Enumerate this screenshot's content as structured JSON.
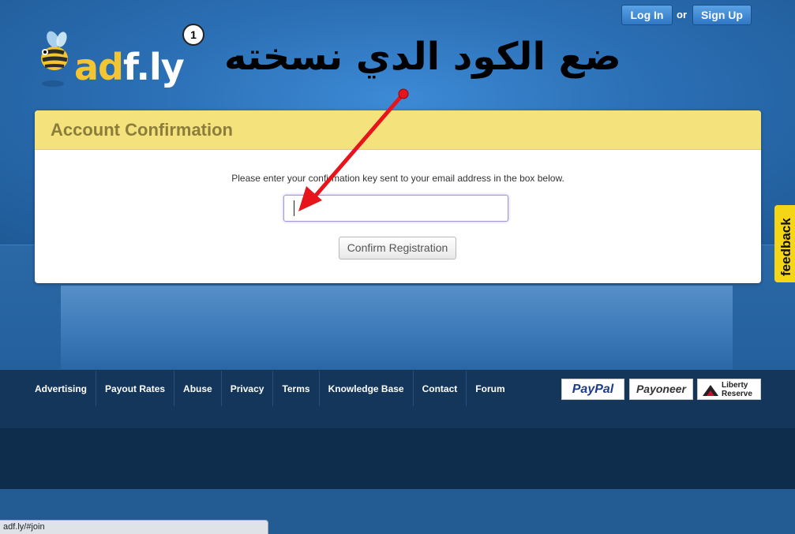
{
  "header": {
    "login_label": "Log In",
    "or_label": "or",
    "signup_label": "Sign Up"
  },
  "logo": {
    "brand_part1": "ad",
    "brand_part2": "f.ly",
    "icon": "bee-icon"
  },
  "annotation": {
    "step_number": "1",
    "arabic_text": "ضع الكود الدي نسخته",
    "arrow_color": "#e8141c"
  },
  "card": {
    "title": "Account Confirmation",
    "instructions": "Please enter your confirmation key sent to your email address in the box below.",
    "input_value": "",
    "button_label": "Confirm Registration"
  },
  "feedback_tab": {
    "label": "feedback"
  },
  "footer": {
    "links": [
      "Advertising",
      "Payout Rates",
      "Abuse",
      "Privacy",
      "Terms",
      "Knowledge Base",
      "Contact",
      "Forum"
    ],
    "payment_logos": {
      "paypal": "PayPal",
      "payoneer": "Payoneer",
      "liberty_line1": "Liberty",
      "liberty_line2": "Reserve"
    }
  },
  "status_bar": {
    "url": "adf.ly/#join"
  },
  "colors": {
    "accent_yellow": "#f4e37d",
    "page_blue": "#2b6fb4",
    "footer_navy": "#13365a",
    "feedback_yellow": "#f5d617"
  }
}
